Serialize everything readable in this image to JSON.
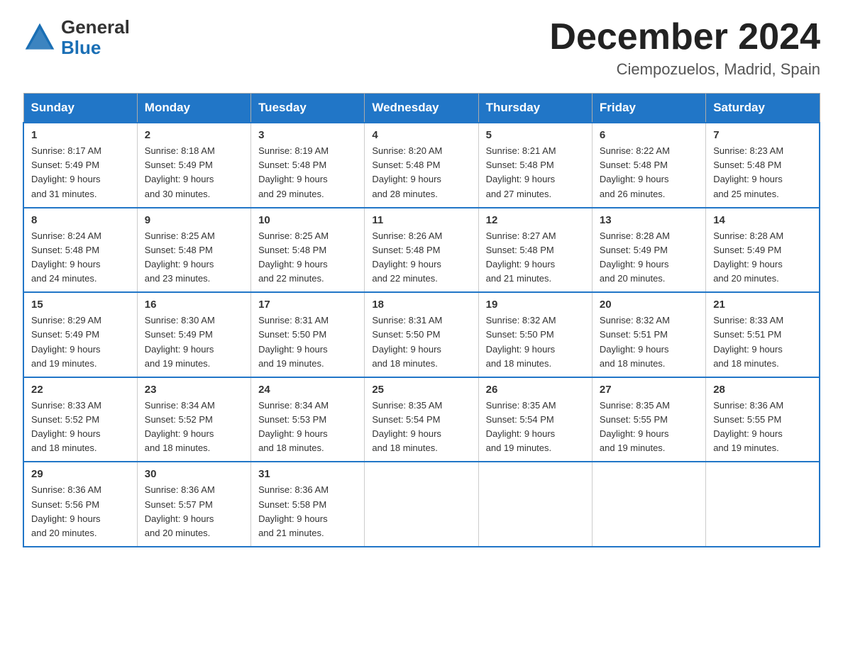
{
  "header": {
    "logo_general": "General",
    "logo_blue": "Blue",
    "month_title": "December 2024",
    "location": "Ciempozuelos, Madrid, Spain"
  },
  "days_of_week": [
    "Sunday",
    "Monday",
    "Tuesday",
    "Wednesday",
    "Thursday",
    "Friday",
    "Saturday"
  ],
  "weeks": [
    [
      {
        "day": "1",
        "sunrise": "8:17 AM",
        "sunset": "5:49 PM",
        "daylight": "9 hours and 31 minutes."
      },
      {
        "day": "2",
        "sunrise": "8:18 AM",
        "sunset": "5:49 PM",
        "daylight": "9 hours and 30 minutes."
      },
      {
        "day": "3",
        "sunrise": "8:19 AM",
        "sunset": "5:48 PM",
        "daylight": "9 hours and 29 minutes."
      },
      {
        "day": "4",
        "sunrise": "8:20 AM",
        "sunset": "5:48 PM",
        "daylight": "9 hours and 28 minutes."
      },
      {
        "day": "5",
        "sunrise": "8:21 AM",
        "sunset": "5:48 PM",
        "daylight": "9 hours and 27 minutes."
      },
      {
        "day": "6",
        "sunrise": "8:22 AM",
        "sunset": "5:48 PM",
        "daylight": "9 hours and 26 minutes."
      },
      {
        "day": "7",
        "sunrise": "8:23 AM",
        "sunset": "5:48 PM",
        "daylight": "9 hours and 25 minutes."
      }
    ],
    [
      {
        "day": "8",
        "sunrise": "8:24 AM",
        "sunset": "5:48 PM",
        "daylight": "9 hours and 24 minutes."
      },
      {
        "day": "9",
        "sunrise": "8:25 AM",
        "sunset": "5:48 PM",
        "daylight": "9 hours and 23 minutes."
      },
      {
        "day": "10",
        "sunrise": "8:25 AM",
        "sunset": "5:48 PM",
        "daylight": "9 hours and 22 minutes."
      },
      {
        "day": "11",
        "sunrise": "8:26 AM",
        "sunset": "5:48 PM",
        "daylight": "9 hours and 22 minutes."
      },
      {
        "day": "12",
        "sunrise": "8:27 AM",
        "sunset": "5:48 PM",
        "daylight": "9 hours and 21 minutes."
      },
      {
        "day": "13",
        "sunrise": "8:28 AM",
        "sunset": "5:49 PM",
        "daylight": "9 hours and 20 minutes."
      },
      {
        "day": "14",
        "sunrise": "8:28 AM",
        "sunset": "5:49 PM",
        "daylight": "9 hours and 20 minutes."
      }
    ],
    [
      {
        "day": "15",
        "sunrise": "8:29 AM",
        "sunset": "5:49 PM",
        "daylight": "9 hours and 19 minutes."
      },
      {
        "day": "16",
        "sunrise": "8:30 AM",
        "sunset": "5:49 PM",
        "daylight": "9 hours and 19 minutes."
      },
      {
        "day": "17",
        "sunrise": "8:31 AM",
        "sunset": "5:50 PM",
        "daylight": "9 hours and 19 minutes."
      },
      {
        "day": "18",
        "sunrise": "8:31 AM",
        "sunset": "5:50 PM",
        "daylight": "9 hours and 18 minutes."
      },
      {
        "day": "19",
        "sunrise": "8:32 AM",
        "sunset": "5:50 PM",
        "daylight": "9 hours and 18 minutes."
      },
      {
        "day": "20",
        "sunrise": "8:32 AM",
        "sunset": "5:51 PM",
        "daylight": "9 hours and 18 minutes."
      },
      {
        "day": "21",
        "sunrise": "8:33 AM",
        "sunset": "5:51 PM",
        "daylight": "9 hours and 18 minutes."
      }
    ],
    [
      {
        "day": "22",
        "sunrise": "8:33 AM",
        "sunset": "5:52 PM",
        "daylight": "9 hours and 18 minutes."
      },
      {
        "day": "23",
        "sunrise": "8:34 AM",
        "sunset": "5:52 PM",
        "daylight": "9 hours and 18 minutes."
      },
      {
        "day": "24",
        "sunrise": "8:34 AM",
        "sunset": "5:53 PM",
        "daylight": "9 hours and 18 minutes."
      },
      {
        "day": "25",
        "sunrise": "8:35 AM",
        "sunset": "5:54 PM",
        "daylight": "9 hours and 18 minutes."
      },
      {
        "day": "26",
        "sunrise": "8:35 AM",
        "sunset": "5:54 PM",
        "daylight": "9 hours and 19 minutes."
      },
      {
        "day": "27",
        "sunrise": "8:35 AM",
        "sunset": "5:55 PM",
        "daylight": "9 hours and 19 minutes."
      },
      {
        "day": "28",
        "sunrise": "8:36 AM",
        "sunset": "5:55 PM",
        "daylight": "9 hours and 19 minutes."
      }
    ],
    [
      {
        "day": "29",
        "sunrise": "8:36 AM",
        "sunset": "5:56 PM",
        "daylight": "9 hours and 20 minutes."
      },
      {
        "day": "30",
        "sunrise": "8:36 AM",
        "sunset": "5:57 PM",
        "daylight": "9 hours and 20 minutes."
      },
      {
        "day": "31",
        "sunrise": "8:36 AM",
        "sunset": "5:58 PM",
        "daylight": "9 hours and 21 minutes."
      },
      null,
      null,
      null,
      null
    ]
  ],
  "labels": {
    "sunrise": "Sunrise:",
    "sunset": "Sunset:",
    "daylight": "Daylight:"
  }
}
